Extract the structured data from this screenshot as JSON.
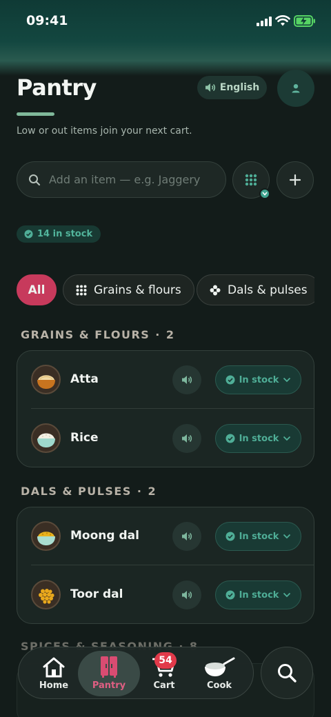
{
  "status_bar": {
    "time": "09:41"
  },
  "header": {
    "title": "Pantry",
    "subtitle": "Low or out items join your next cart.",
    "language_label": "English"
  },
  "search": {
    "placeholder": "Add an item — e.g. Jaggery",
    "value": ""
  },
  "summary": {
    "in_stock_label": "14 in stock"
  },
  "filters": [
    {
      "label": "All",
      "icon": "none",
      "active": true
    },
    {
      "label": "Grains & flours",
      "icon": "grid-dots-icon",
      "active": false
    },
    {
      "label": "Dals & pulses",
      "icon": "flower-icon",
      "active": false
    }
  ],
  "sections": [
    {
      "title": "GRAINS & FLOURS",
      "count": "2",
      "items": [
        {
          "name": "Atta",
          "status": "In stock",
          "icon": "flour-bowl-icon"
        },
        {
          "name": "Rice",
          "status": "In stock",
          "icon": "rice-bowl-icon"
        }
      ]
    },
    {
      "title": "DALS & PULSES",
      "count": "2",
      "items": [
        {
          "name": "Moong dal",
          "status": "In stock",
          "icon": "dal-bowl-icon"
        },
        {
          "name": "Toor dal",
          "status": "In stock",
          "icon": "lentils-icon"
        }
      ]
    },
    {
      "title": "SPICES & SEASONING",
      "count": "8"
    }
  ],
  "tabbar": {
    "tabs": [
      {
        "label": "Home",
        "icon": "house-icon",
        "active": false
      },
      {
        "label": "Pantry",
        "icon": "cupboard-icon",
        "active": true
      },
      {
        "label": "Cart",
        "icon": "cart-icon",
        "active": false
      },
      {
        "label": "Cook",
        "icon": "wok-icon",
        "active": false
      }
    ],
    "cart_badge": "54"
  },
  "colors": {
    "background": "#131c1a",
    "accent_pink": "#c73a5c",
    "accent_green": "#4fae97",
    "header_teal": "#134740"
  }
}
